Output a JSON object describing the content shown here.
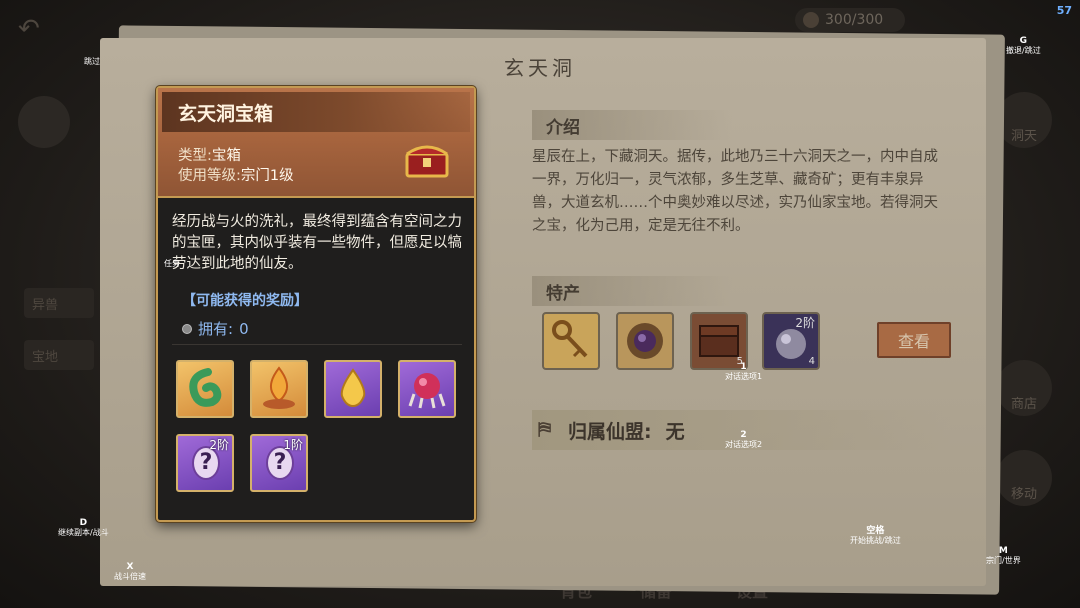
{
  "hud": {
    "fps": "57",
    "currency_value": "300/300",
    "back_label": "跳过",
    "left_labels": [
      "任务",
      "异兽",
      "宝地"
    ],
    "right_labels": [
      "商店",
      "移动",
      "洞天"
    ],
    "bottom_tabs": [
      "背包",
      "储备",
      "设置"
    ]
  },
  "panel": {
    "title": "玄天洞",
    "intro_heading": "介绍",
    "intro_text": "星辰在上，下藏洞天。据传，此地乃三十六洞天之一，内中自成一界，万化归一，灵气浓郁，多生芝草、藏奇矿；更有丰泉异兽，大道玄机……个中奥妙难以尽述，实乃仙家宝地。若得洞天之宝，化为己用，定是无往不利。",
    "specialty_heading": "特产",
    "specialties": [
      {
        "icon": "golden-key-icon",
        "tier": "",
        "count": ""
      },
      {
        "icon": "purple-orb-amulet-icon",
        "tier": "",
        "count": ""
      },
      {
        "icon": "treasure-chest-icon",
        "tier": "",
        "count": "5"
      },
      {
        "icon": "silver-orb-icon",
        "tier": "2阶",
        "count": "4"
      }
    ],
    "view_button": "查看",
    "alliance_label": "归属仙盟:",
    "alliance_value": "无"
  },
  "card": {
    "title": "玄天洞宝箱",
    "type_label": "类型:",
    "type_value": "宝箱",
    "level_label": "使用等级:",
    "level_value": "宗门1级",
    "description": "经历战与火的洗礼，最终得到蕴含有空间之力的宝匣，其内似乎装有一些物件，但愿足以犒劳达到此地的仙友。",
    "rewards_title": "【可能获得的奖励】",
    "owned_label": "拥有:",
    "owned_value": "0",
    "rewards": [
      {
        "icon": "jade-hook-icon",
        "style": "gold",
        "tier": ""
      },
      {
        "icon": "flame-lotus-icon",
        "style": "gold",
        "tier": ""
      },
      {
        "icon": "golden-drop-icon",
        "style": "purple",
        "tier": ""
      },
      {
        "icon": "crimson-orb-claw-icon",
        "style": "purple",
        "tier": ""
      },
      {
        "icon": "mystery-box-icon",
        "style": "purple",
        "tier": "2阶"
      },
      {
        "icon": "mystery-box-icon",
        "style": "purple",
        "tier": "1阶"
      }
    ]
  },
  "hints": {
    "skip": {
      "key": "",
      "label": "跳过"
    },
    "g": {
      "key": "G",
      "label": "撤退/跳过"
    },
    "task": {
      "key": "",
      "label": "任务"
    },
    "opt1": {
      "key": "1",
      "label": "对话选项1"
    },
    "opt2": {
      "key": "2",
      "label": "对话选项2"
    },
    "d": {
      "key": "D",
      "label": "继续副本/战斗"
    },
    "x": {
      "key": "X",
      "label": "战斗倍速"
    },
    "space": {
      "key": "空格",
      "label": "开始挑战/跳过"
    },
    "m": {
      "key": "M",
      "label": "宗门/世界"
    }
  }
}
